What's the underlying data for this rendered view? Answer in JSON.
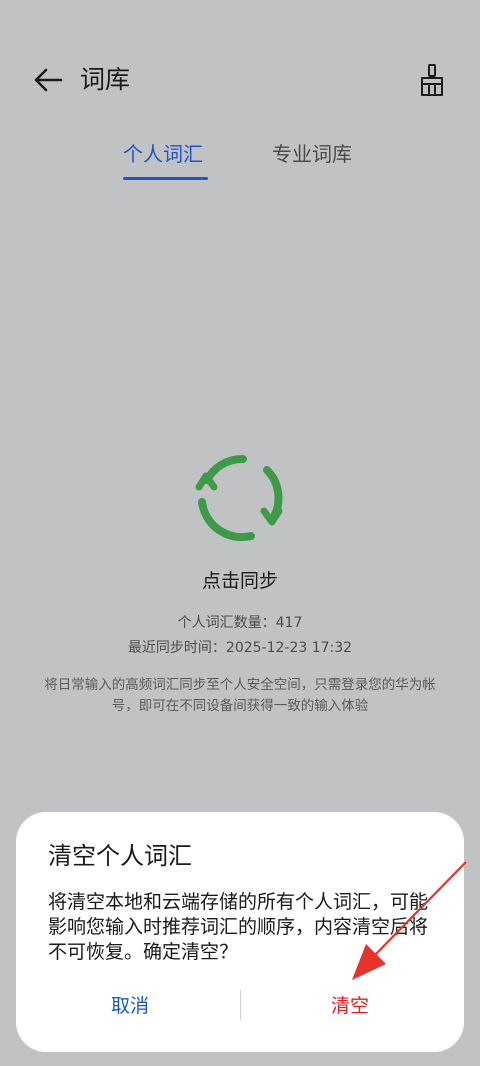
{
  "header": {
    "title": "词库",
    "back_icon": "arrow-left-icon",
    "clean_icon": "broom-icon"
  },
  "tabs": [
    {
      "label": "个人词汇",
      "active": true
    },
    {
      "label": "专业词库",
      "active": false
    }
  ],
  "sync": {
    "icon": "sync-icon",
    "label": "点击同步",
    "count_text": "个人词汇数量：417",
    "time_text": "最近同步时间：2025-12-23 17:32",
    "description": "将日常输入的高频词汇同步至个人安全空间，只需登录您的华为帐号，即可在不同设备间获得一致的输入体验"
  },
  "dialog": {
    "title": "清空个人词汇",
    "body": "将清空本地和云端存储的所有个人词汇，可能影响您输入时推荐词汇的顺序，内容清空后将不可恢复。确定清空？",
    "cancel_label": "取消",
    "confirm_label": "清空"
  },
  "colors": {
    "accent": "#1d56c9",
    "danger": "#e02020",
    "sync_green": "#3f9a48",
    "backdrop": "#c1c2c4"
  }
}
